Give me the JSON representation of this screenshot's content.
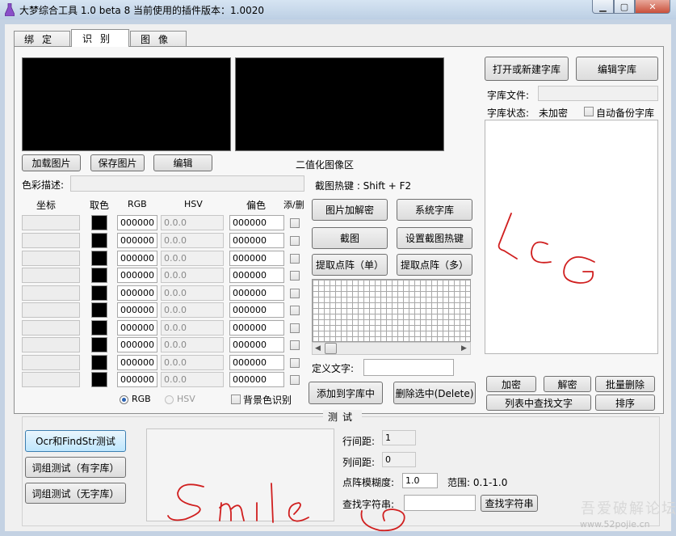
{
  "window": {
    "title": "大梦综合工具 1.0 beta 8   当前使用的插件版本：1.0020",
    "minimize_glyph": "▁",
    "maximize_glyph": "▢",
    "close_glyph": "✕"
  },
  "tabs": [
    {
      "label": "绑定",
      "active": false
    },
    {
      "label": "识别",
      "active": true
    },
    {
      "label": "图像",
      "active": false
    }
  ],
  "image_area": {
    "binary_label": "二值化图像区",
    "load_button": "加载图片",
    "save_button": "保存图片",
    "edit_button": "编辑"
  },
  "color_desc": {
    "label": "色彩描述:",
    "value": ""
  },
  "color_table": {
    "headers": {
      "coord": "坐标",
      "color": "取色",
      "rgb": "RGB",
      "hsv": "HSV",
      "offset": "偏色",
      "add_delete": "添/删"
    },
    "rows": [
      {
        "rgb": "000000",
        "hsv": "0.0.0",
        "offset": "000000"
      },
      {
        "rgb": "000000",
        "hsv": "0.0.0",
        "offset": "000000"
      },
      {
        "rgb": "000000",
        "hsv": "0.0.0",
        "offset": "000000"
      },
      {
        "rgb": "000000",
        "hsv": "0.0.0",
        "offset": "000000"
      },
      {
        "rgb": "000000",
        "hsv": "0.0.0",
        "offset": "000000"
      },
      {
        "rgb": "000000",
        "hsv": "0.0.0",
        "offset": "000000"
      },
      {
        "rgb": "000000",
        "hsv": "0.0.0",
        "offset": "000000"
      },
      {
        "rgb": "000000",
        "hsv": "0.0.0",
        "offset": "000000"
      },
      {
        "rgb": "000000",
        "hsv": "0.0.0",
        "offset": "000000"
      },
      {
        "rgb": "000000",
        "hsv": "0.0.0",
        "offset": "000000"
      }
    ],
    "radio_rgb": "RGB",
    "radio_hsv": "HSV",
    "bg_color_checkbox": "背景色识别"
  },
  "capture": {
    "hotkey_label": "截图热键 : Shift + F2",
    "decrypt_image": "图片加解密",
    "system_library": "系统字库",
    "screenshot": "截图",
    "set_hotkey": "设置截图热键",
    "extract_single": "提取点阵（单）",
    "extract_multi": "提取点阵（多）",
    "define_text_label": "定义文字:",
    "define_text_value": "",
    "add_to_library": "添加到字库中",
    "delete_selected": "删除选中(Delete)"
  },
  "library": {
    "open_create": "打开或新建字库",
    "edit_library": "编辑字库",
    "file_label": "字库文件:",
    "file_value": "",
    "status_label": "字库状态:",
    "status_value": "未加密",
    "auto_backup": "自动备份字库",
    "encrypt": "加密",
    "decrypt": "解密",
    "batch_delete": "批量删除",
    "find_in_list": "列表中查找文字",
    "sort": "排序"
  },
  "test": {
    "group_label": "测试",
    "ocr_findstr": "Ocr和FindStr测试",
    "phrase_with_lib": "词组测试（有字库）",
    "phrase_without_lib": "词组测试（无字库）",
    "line_spacing_label": "行间距:",
    "line_spacing_value": "1",
    "col_spacing_label": "列间距:",
    "col_spacing_value": "0",
    "fuzzy_label": "点阵模糊度:",
    "fuzzy_value": "1.0",
    "range_label": "范围: 0.1-1.0",
    "search_label": "查找字符串:",
    "search_value": "",
    "search_button": "查找字符串"
  },
  "watermark": {
    "text": "吾爱破解论坛",
    "url": "www.52pojie.cn"
  },
  "colors": {
    "scribble": "#d01f1f",
    "window_frame": "#c4d2e3",
    "close_button": "#c9503b"
  },
  "icons": {
    "app": "app-flask-icon",
    "radio": "radio-icon",
    "checkbox": "checkbox-icon"
  }
}
